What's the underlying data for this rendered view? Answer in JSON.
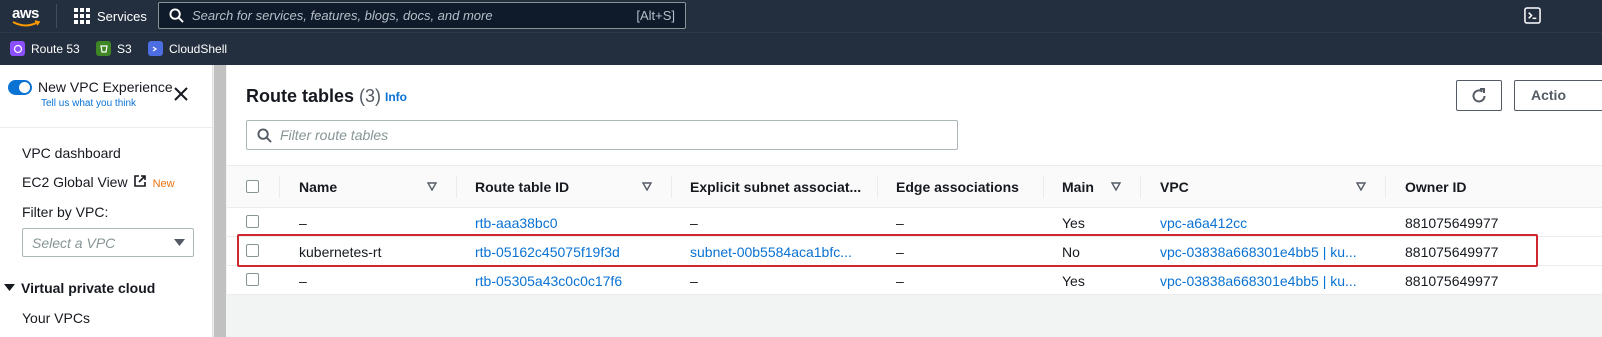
{
  "topnav": {
    "logo": "aws",
    "services_label": "Services",
    "search_placeholder": "Search for services, features, blogs, docs, and more",
    "search_shortcut": "[Alt+S]"
  },
  "favorites": [
    {
      "label": "Route 53",
      "icon": "route53-icon",
      "color": "#8c4fff"
    },
    {
      "label": "S3",
      "icon": "s3-icon",
      "color": "#3f8624"
    },
    {
      "label": "CloudShell",
      "icon": "cloudshell-icon",
      "color": "#4d6ee3"
    }
  ],
  "sidebar": {
    "toggle_label": "New VPC Experience",
    "toggle_sub": "Tell us what you think",
    "items": [
      {
        "label": "VPC dashboard"
      },
      {
        "label": "EC2 Global View",
        "badge": "New"
      }
    ],
    "filter_label": "Filter by VPC:",
    "filter_placeholder": "Select a VPC",
    "section": "Virtual private cloud",
    "section_items": [
      {
        "label": "Your VPCs"
      }
    ]
  },
  "main": {
    "title": "Route tables",
    "count": "(3)",
    "info": "Info",
    "actions_label": "Actio",
    "filter_placeholder": "Filter route tables",
    "columns": [
      "Name",
      "Route table ID",
      "Explicit subnet associat...",
      "Edge associations",
      "Main",
      "VPC",
      "Owner ID"
    ],
    "rows": [
      {
        "name": "–",
        "id": "rtb-aaa38bc0",
        "subnet": "–",
        "edge": "–",
        "main": "Yes",
        "vpc": "vpc-a6a412cc",
        "owner": "881075649977"
      },
      {
        "name": "kubernetes-rt",
        "id": "rtb-05162c45075f19f3d",
        "subnet": "subnet-00b5584aca1bfc...",
        "edge": "–",
        "main": "No",
        "vpc": "vpc-03838a668301e4bb5 | ku...",
        "owner": "881075649977"
      },
      {
        "name": "–",
        "id": "rtb-05305a43c0c0c17f6",
        "subnet": "–",
        "edge": "–",
        "main": "Yes",
        "vpc": "vpc-03838a668301e4bb5 | ku...",
        "owner": "881075649977"
      }
    ]
  }
}
